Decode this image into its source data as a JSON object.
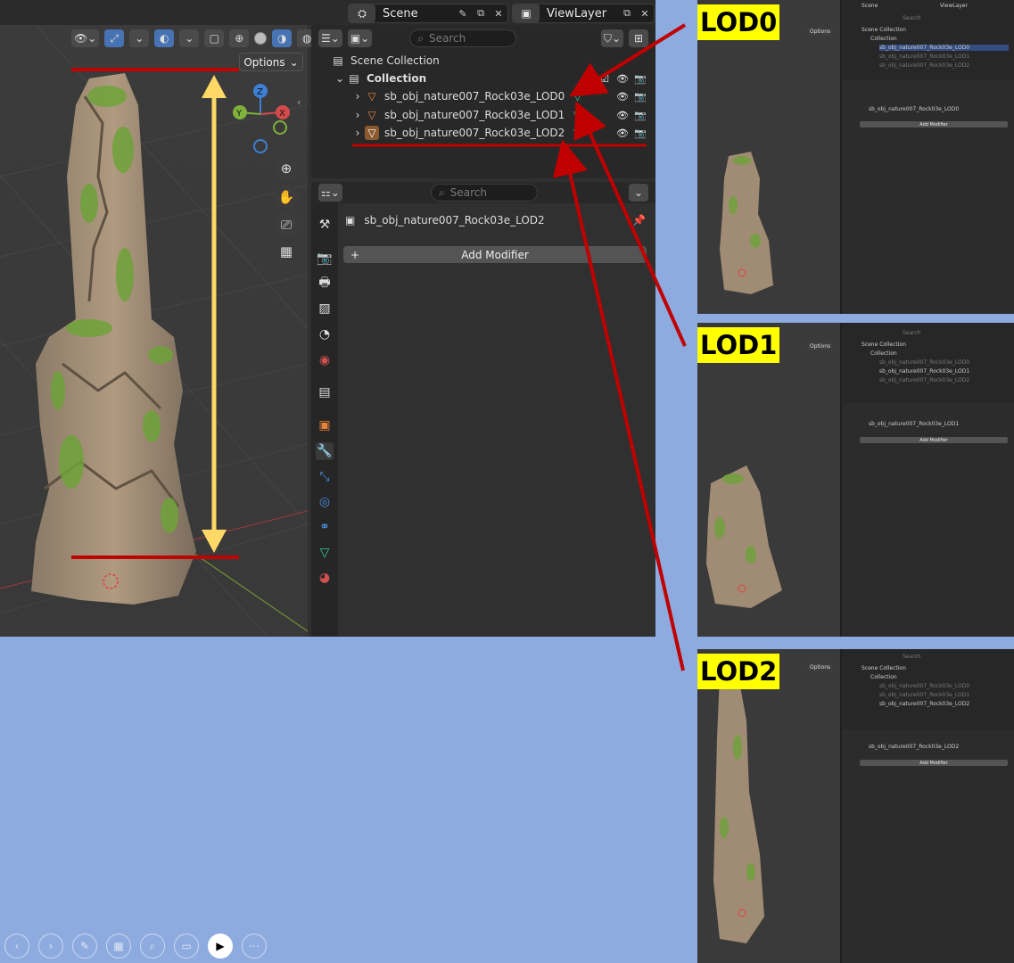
{
  "topbar": {
    "scene_label": "Scene",
    "viewlayer_label": "ViewLayer"
  },
  "viewport": {
    "options_label": "Options",
    "axis_x": "X",
    "axis_y": "Y",
    "axis_z": "Z"
  },
  "outliner": {
    "search_placeholder": "Search",
    "scene_collection": "Scene Collection",
    "collection": "Collection",
    "items": [
      {
        "label": "sb_obj_nature007_Rock03e_LOD0"
      },
      {
        "label": "sb_obj_nature007_Rock03e_LOD1"
      },
      {
        "label": "sb_obj_nature007_Rock03e_LOD2"
      }
    ]
  },
  "properties": {
    "search_placeholder": "Search",
    "object_name": "sb_obj_nature007_Rock03e_LOD2",
    "add_modifier_label": "Add Modifier"
  },
  "thumbnails": [
    {
      "lod_label": "LOD0",
      "scene_label": "Scene",
      "viewlayer_label": "ViewLayer",
      "options_label": "Options",
      "scene_collection": "Scene Collection",
      "collection": "Collection",
      "items": [
        "sb_obj_nature007_Rock03e_LOD0",
        "sb_obj_nature007_Rock03e_LOD1",
        "sb_obj_nature007_Rock03e_LOD2"
      ],
      "object_name": "sb_obj_nature007_Rock03e_LOD0",
      "add_modifier_label": "Add Modifier",
      "search_placeholder": "Search"
    },
    {
      "lod_label": "LOD1",
      "options_label": "Options",
      "scene_collection": "Scene Collection",
      "collection": "Collection",
      "items": [
        "sb_obj_nature007_Rock03e_LOD0",
        "sb_obj_nature007_Rock03e_LOD1",
        "sb_obj_nature007_Rock03e_LOD2"
      ],
      "object_name": "sb_obj_nature007_Rock03e_LOD1",
      "add_modifier_label": "Add Modifier",
      "search_placeholder": "Search"
    },
    {
      "lod_label": "LOD2",
      "options_label": "Options",
      "scene_collection": "Scene Collection",
      "collection": "Collection",
      "items": [
        "sb_obj_nature007_Rock03e_LOD0",
        "sb_obj_nature007_Rock03e_LOD1",
        "sb_obj_nature007_Rock03e_LOD2"
      ],
      "object_name": "sb_obj_nature007_Rock03e_LOD2",
      "add_modifier_label": "Add Modifier",
      "search_placeholder": "Search"
    }
  ],
  "colors": {
    "accent": "#4772b3",
    "annotation_red": "#c00000",
    "annotation_yellow": "#ffd866",
    "label_yellow": "#ffff00",
    "mesh_green": "#35c7a0",
    "object_orange": "#e8843a",
    "background": "#8eabdf"
  },
  "presentation_controls": [
    "prev-icon",
    "next-icon",
    "pen-icon",
    "slides-icon",
    "zoom-icon",
    "blank-icon",
    "camera-icon",
    "more-icon"
  ]
}
